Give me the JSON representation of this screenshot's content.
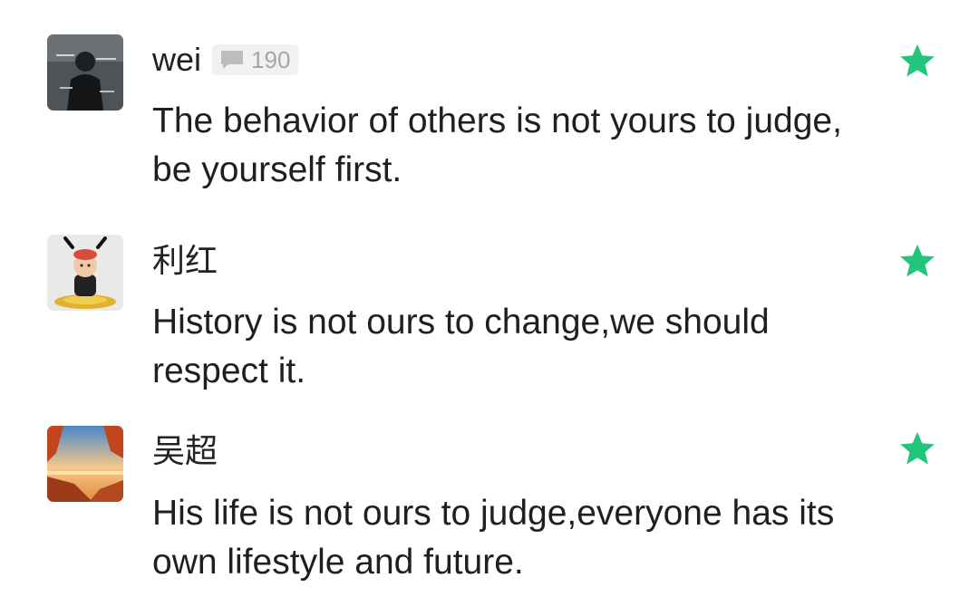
{
  "comments": [
    {
      "username": "wei",
      "badge_count": "190",
      "text": "The behavior of others is not yours to judge, be yourself first.",
      "star_color": "#22c67a"
    },
    {
      "username": "利红",
      "text": "History is not ours to change,we should respect it.",
      "star_color": "#22c67a"
    },
    {
      "username": "吴超",
      "text": "His life is not ours to judge,everyone has its own lifestyle and future.",
      "star_color": "#22c67a"
    }
  ]
}
